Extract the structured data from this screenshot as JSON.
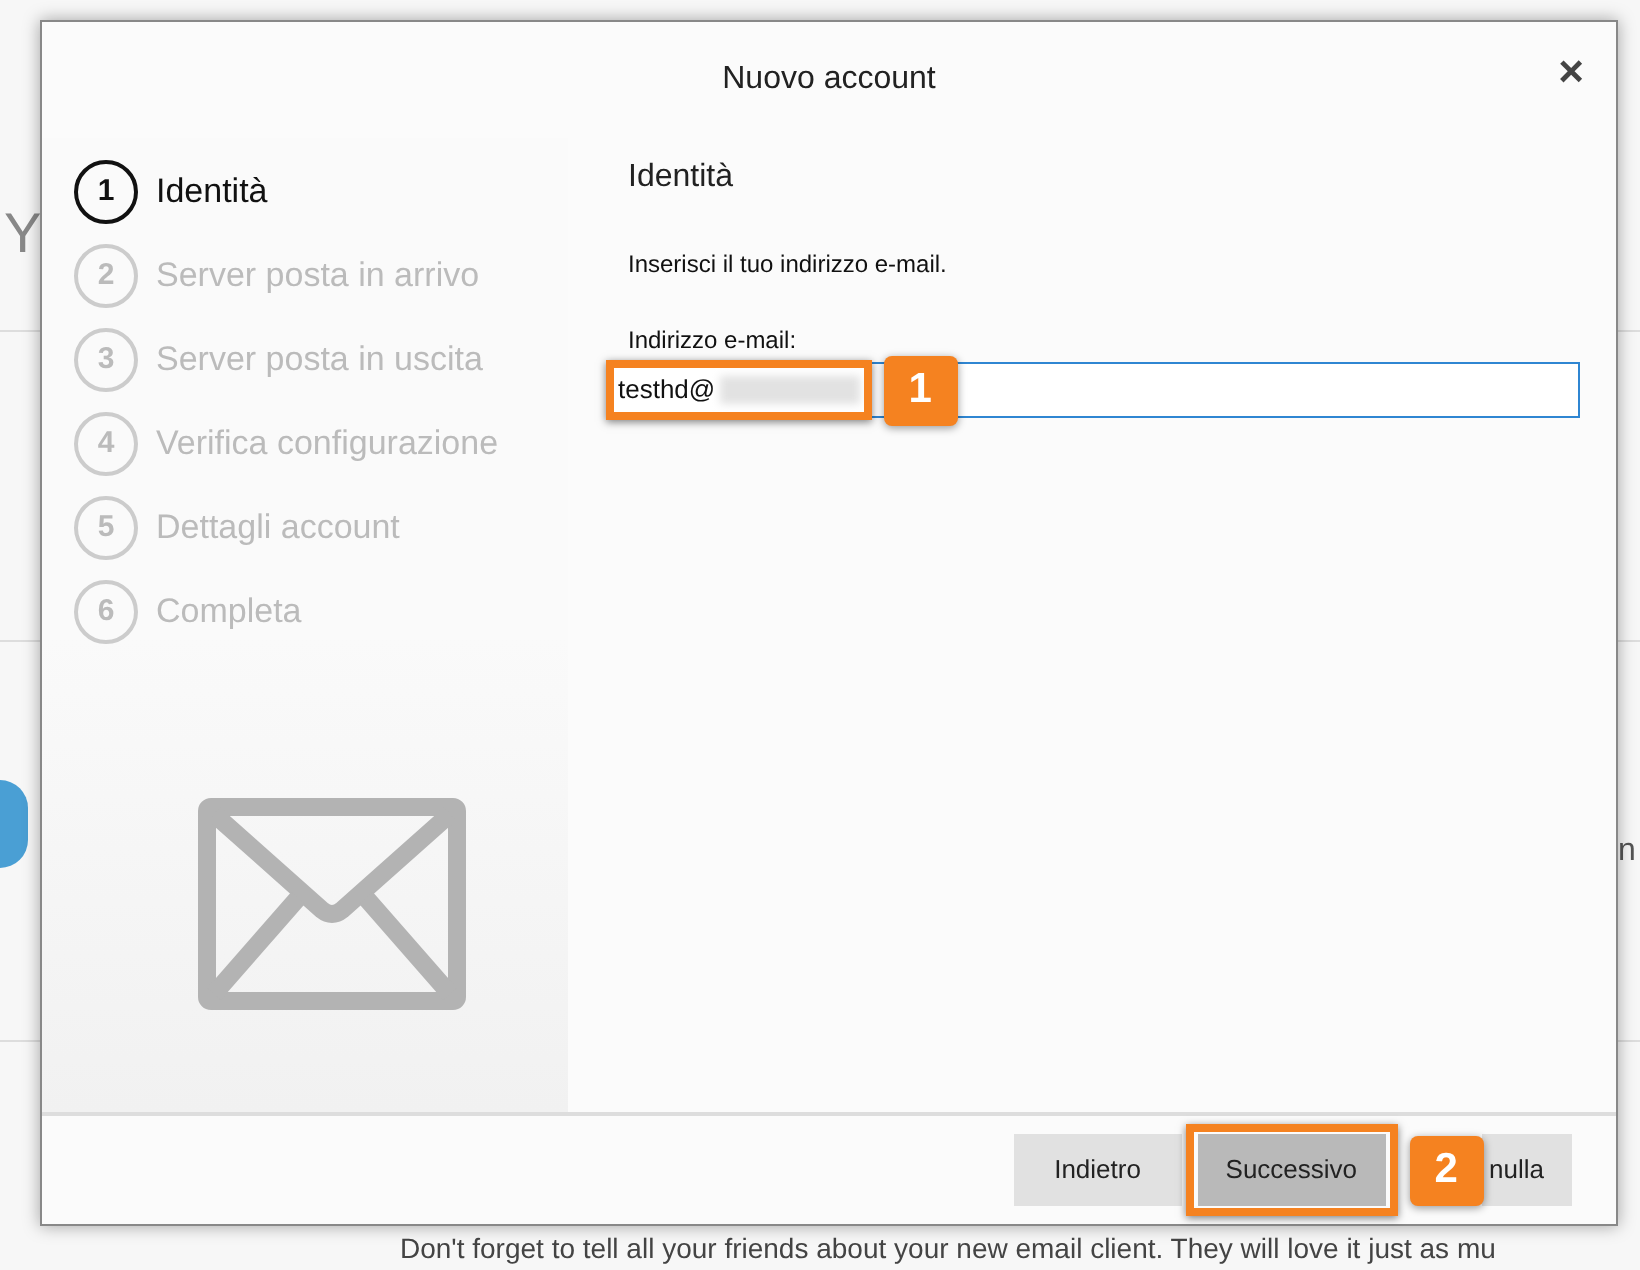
{
  "background": {
    "left_fragment": "Y",
    "right_fragment": "n",
    "footer_text": "Don't forget to tell all your friends about your new email client. They will love it just as mu"
  },
  "window": {
    "title": "Nuovo account",
    "close": "×"
  },
  "steps": [
    {
      "number": "1",
      "label": "Identità",
      "selected": true
    },
    {
      "number": "2",
      "label": "Server posta in arrivo",
      "selected": false
    },
    {
      "number": "3",
      "label": "Server posta in uscita",
      "selected": false
    },
    {
      "number": "4",
      "label": "Verifica configurazione",
      "selected": false
    },
    {
      "number": "5",
      "label": "Dettagli account",
      "selected": false
    },
    {
      "number": "6",
      "label": "Completa",
      "selected": false
    }
  ],
  "page": {
    "heading": "Identità",
    "instruction": "Inserisci il tuo indirizzo e-mail.",
    "email_label": "Indirizzo e-mail:",
    "email_value": "testhd@",
    "email_blurred": true
  },
  "buttons": [
    {
      "label": "Indietro",
      "selected": false
    },
    {
      "label": "Successivo",
      "selected": true
    },
    {
      "label": "nulla",
      "selected": false
    }
  ],
  "annotations": [
    {
      "number": "1"
    },
    {
      "number": "2"
    }
  ]
}
